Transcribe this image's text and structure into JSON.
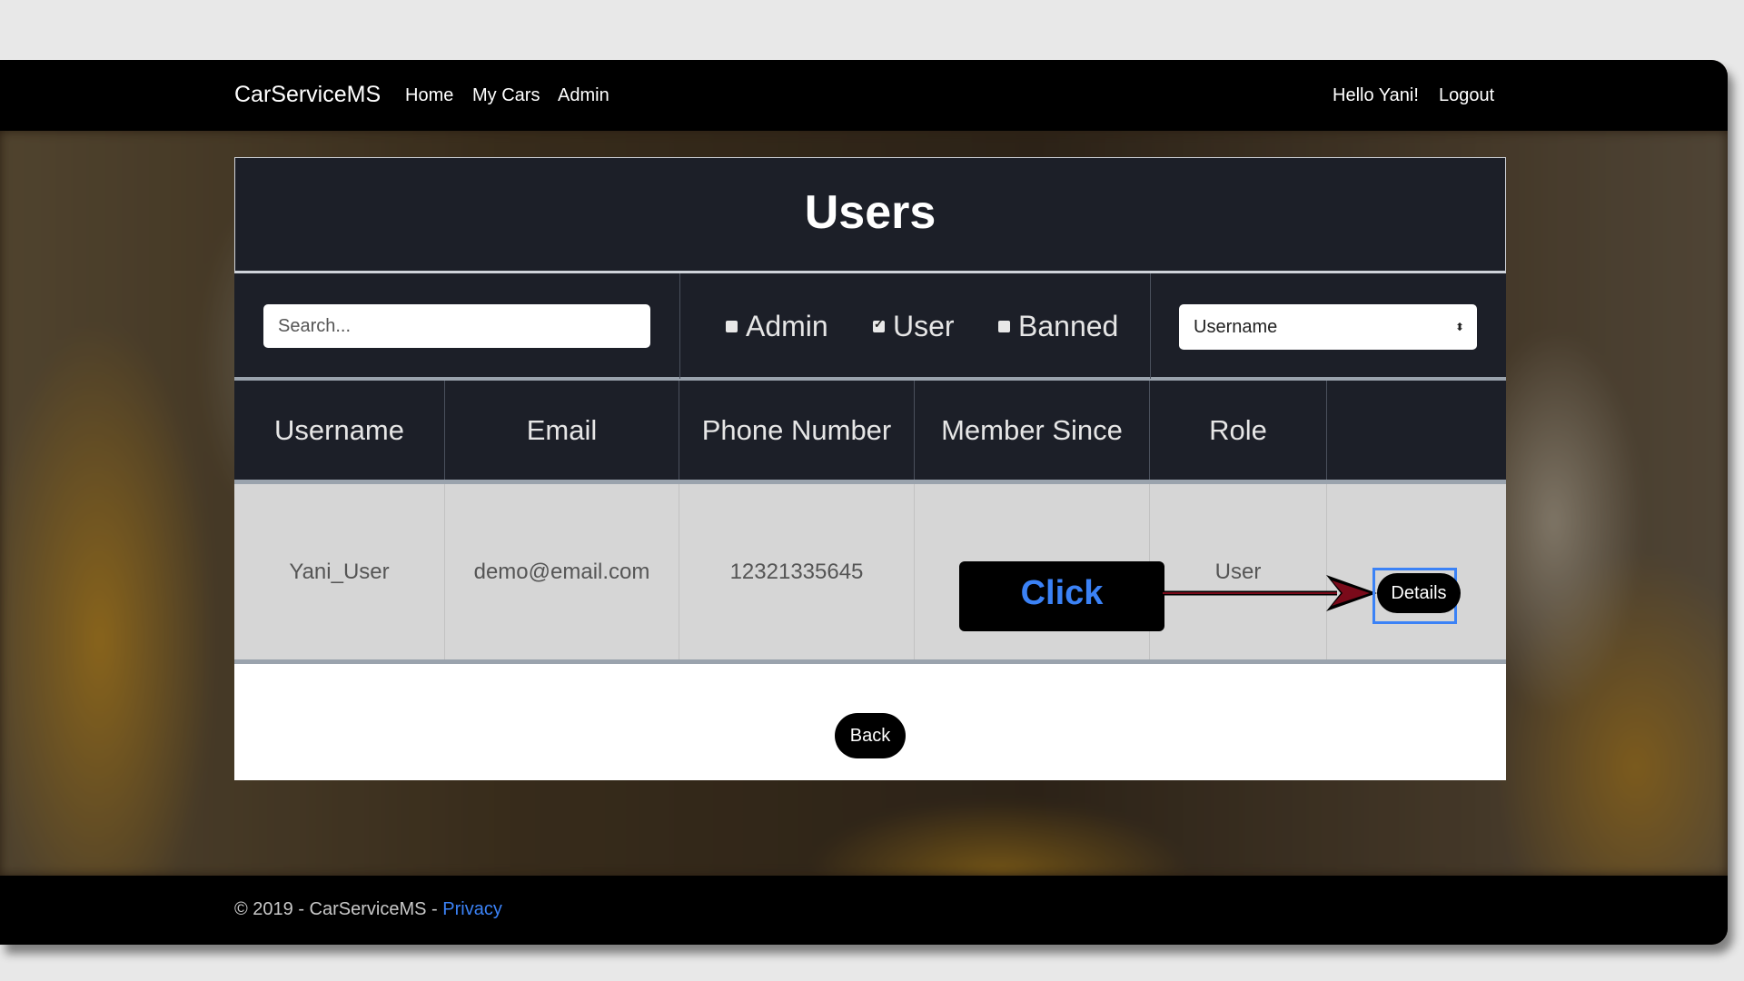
{
  "navbar": {
    "brand": "CarServiceMS",
    "links": [
      "Home",
      "My Cars",
      "Admin"
    ],
    "greeting": "Hello Yani!",
    "logout": "Logout"
  },
  "page": {
    "title": "Users",
    "search_placeholder": "Search...",
    "filters": [
      {
        "label": "Admin",
        "checked": false
      },
      {
        "label": "User",
        "checked": true
      },
      {
        "label": "Banned",
        "checked": false
      }
    ],
    "sort_select": "Username",
    "columns": [
      "Username",
      "Email",
      "Phone Number",
      "Member Since",
      "Role",
      ""
    ],
    "rows": [
      {
        "username": "Yani_User",
        "email": "demo@email.com",
        "phone": "12321335645",
        "member_since": "",
        "role": "User"
      }
    ],
    "details_label": "Details",
    "back_label": "Back"
  },
  "annotation": {
    "callout_text": "Click",
    "callout_color": "#3b82f6",
    "arrow_color": "#7a0a1a"
  },
  "footer": {
    "text": "© 2019 - CarServiceMS - ",
    "link": "Privacy"
  }
}
